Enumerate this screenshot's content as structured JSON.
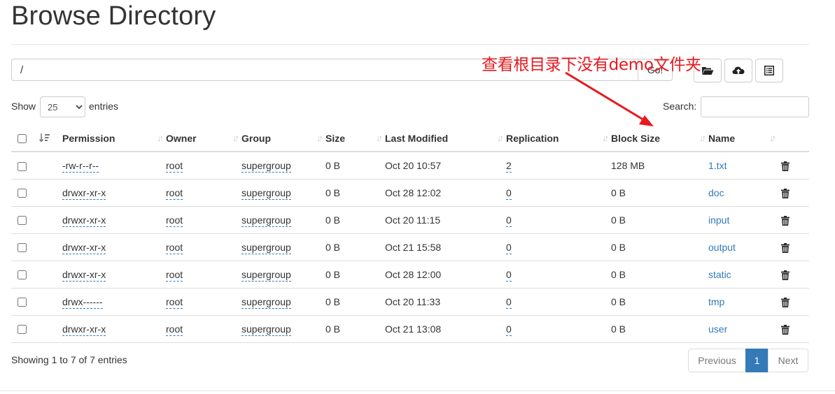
{
  "header": {
    "title": "Browse Directory"
  },
  "path_bar": {
    "value": "/",
    "go_label": "Go!"
  },
  "toolbar": {
    "create_dir_icon": "folder-open-icon",
    "upload_icon": "cloud-upload-icon",
    "cut_paste_icon": "list-icon"
  },
  "annotation": {
    "text": "查看根目录下没有demo文件夹",
    "color": "#e8191f"
  },
  "controls": {
    "show_label": "Show",
    "page_size": "25",
    "page_size_options": [
      "25"
    ],
    "entries_label": "entries",
    "search_label": "Search:"
  },
  "table": {
    "headers": [
      "Permission",
      "Owner",
      "Group",
      "Size",
      "Last Modified",
      "Replication",
      "Block Size",
      "Name"
    ],
    "rows": [
      {
        "permission": "-rw-r--r--",
        "owner": "root",
        "group": "supergroup",
        "size": "0 B",
        "modified": "Oct 20 10:57",
        "replication": "2",
        "block_size": "128 MB",
        "name": "1.txt"
      },
      {
        "permission": "drwxr-xr-x",
        "owner": "root",
        "group": "supergroup",
        "size": "0 B",
        "modified": "Oct 28 12:02",
        "replication": "0",
        "block_size": "0 B",
        "name": "doc"
      },
      {
        "permission": "drwxr-xr-x",
        "owner": "root",
        "group": "supergroup",
        "size": "0 B",
        "modified": "Oct 20 11:15",
        "replication": "0",
        "block_size": "0 B",
        "name": "input"
      },
      {
        "permission": "drwxr-xr-x",
        "owner": "root",
        "group": "supergroup",
        "size": "0 B",
        "modified": "Oct 21 15:58",
        "replication": "0",
        "block_size": "0 B",
        "name": "output"
      },
      {
        "permission": "drwxr-xr-x",
        "owner": "root",
        "group": "supergroup",
        "size": "0 B",
        "modified": "Oct 28 12:00",
        "replication": "0",
        "block_size": "0 B",
        "name": "static"
      },
      {
        "permission": "drwx------",
        "owner": "root",
        "group": "supergroup",
        "size": "0 B",
        "modified": "Oct 20 11:33",
        "replication": "0",
        "block_size": "0 B",
        "name": "tmp"
      },
      {
        "permission": "drwxr-xr-x",
        "owner": "root",
        "group": "supergroup",
        "size": "0 B",
        "modified": "Oct 21 13:08",
        "replication": "0",
        "block_size": "0 B",
        "name": "user"
      }
    ]
  },
  "footer": {
    "info": "Showing 1 to 7 of 7 entries",
    "previous": "Previous",
    "current_page": "1",
    "next": "Next"
  },
  "colors": {
    "link": "#337ab7",
    "active_page": "#337ab7",
    "annotation": "#e8191f"
  }
}
